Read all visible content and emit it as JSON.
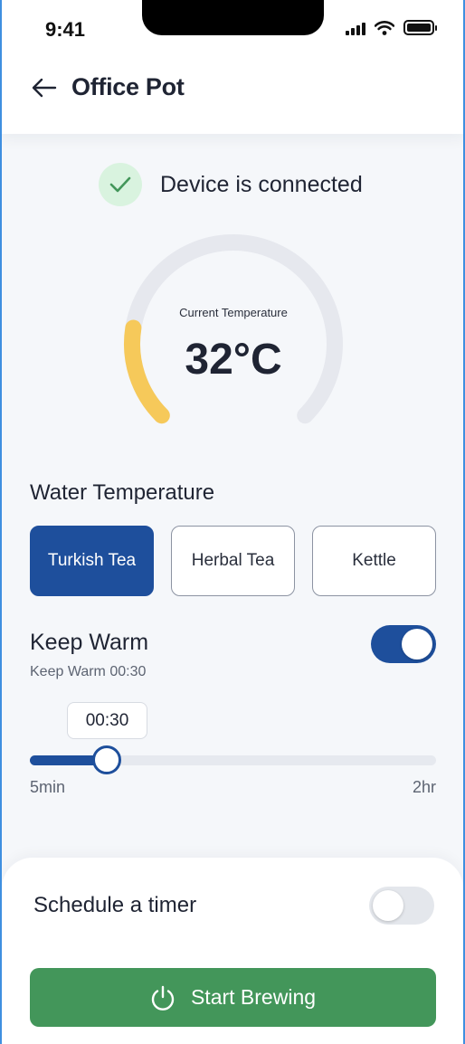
{
  "status_bar": {
    "time": "9:41"
  },
  "header": {
    "title": "Office Pot",
    "back_icon": "arrow-left-icon"
  },
  "connection": {
    "text": "Device is connected",
    "icon": "check-icon",
    "color": "#43965a"
  },
  "gauge": {
    "label": "Current Temperature",
    "value": "32°C",
    "level_fraction": 0.2,
    "accent": "#f6c95a",
    "track": "#e6e8ee"
  },
  "water_temperature": {
    "title": "Water Temperature",
    "options": [
      "Turkish Tea",
      "Herbal Tea",
      "Kettle"
    ],
    "selected": "Turkish Tea"
  },
  "keep_warm": {
    "title": "Keep Warm",
    "subtitle": "Keep Warm 00:30",
    "enabled": true,
    "slider": {
      "tooltip": "00:30",
      "min_label": "5min",
      "max_label": "2hr",
      "fraction": 0.19
    }
  },
  "schedule": {
    "label": "Schedule a timer",
    "enabled": false
  },
  "primary_action": {
    "label": "Start Brewing",
    "icon": "power-icon",
    "color": "#43965a"
  },
  "colors": {
    "primary": "#1e4f9c",
    "success": "#43965a",
    "background": "#f5f7fa"
  }
}
